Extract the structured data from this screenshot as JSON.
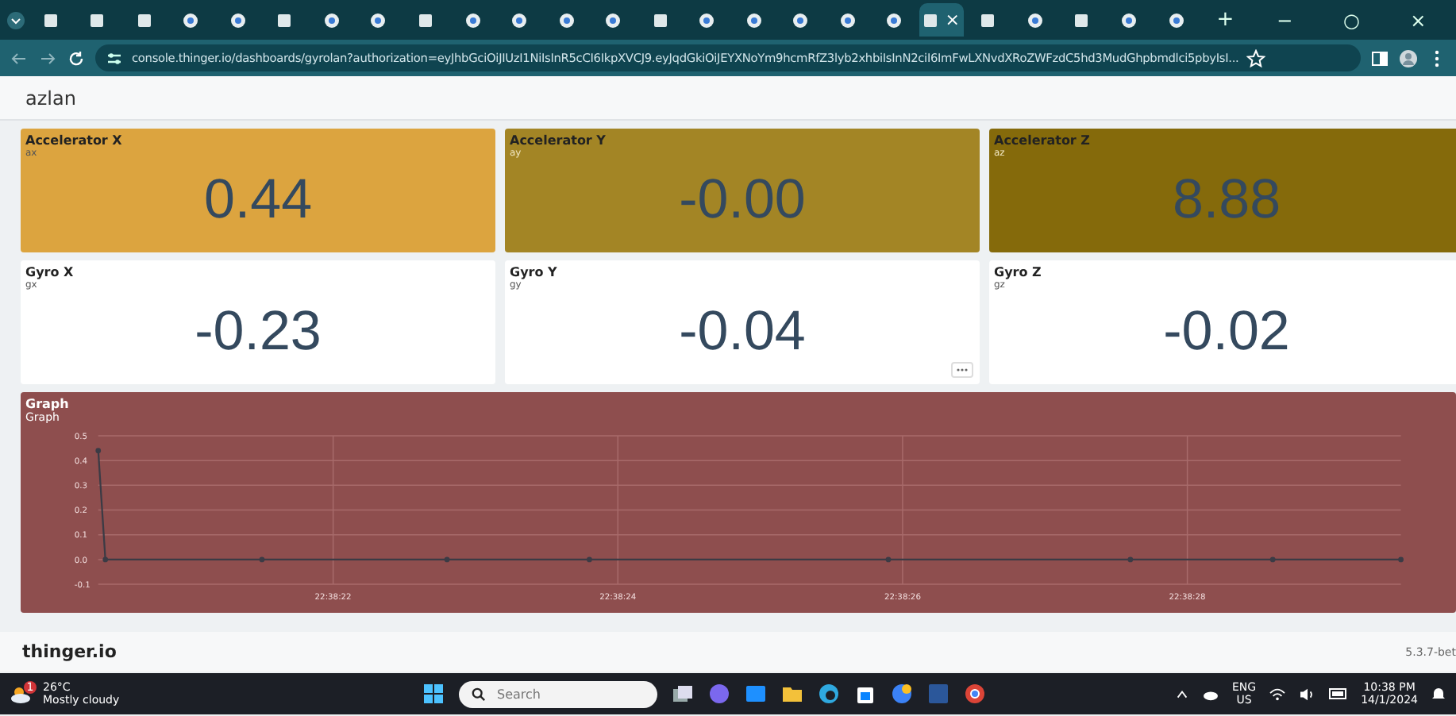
{
  "browser": {
    "tabs": [
      {
        "kind": "square",
        "selected": false
      },
      {
        "kind": "square",
        "selected": false
      },
      {
        "kind": "square",
        "selected": false
      },
      {
        "kind": "circle",
        "selected": false
      },
      {
        "kind": "circle",
        "selected": false
      },
      {
        "kind": "square",
        "selected": false
      },
      {
        "kind": "circle",
        "selected": false
      },
      {
        "kind": "circle",
        "selected": false
      },
      {
        "kind": "square",
        "selected": false
      },
      {
        "kind": "circle",
        "selected": false
      },
      {
        "kind": "circle",
        "selected": false
      },
      {
        "kind": "circle",
        "selected": false
      },
      {
        "kind": "circle",
        "selected": false
      },
      {
        "kind": "square",
        "selected": false
      },
      {
        "kind": "circle",
        "selected": false
      },
      {
        "kind": "circle",
        "selected": false
      },
      {
        "kind": "circle",
        "selected": false
      },
      {
        "kind": "circle",
        "selected": false
      },
      {
        "kind": "circle",
        "selected": false
      },
      {
        "kind": "square",
        "selected": true
      },
      {
        "kind": "square",
        "selected": false
      },
      {
        "kind": "circle",
        "selected": false
      },
      {
        "kind": "square",
        "selected": false
      },
      {
        "kind": "circle",
        "selected": false
      },
      {
        "kind": "circle",
        "selected": false
      }
    ],
    "close_tab": "×",
    "new_tab": "+",
    "window_controls": [
      "−",
      "○",
      "×"
    ],
    "url": "console.thinger.io/dashboards/gyrolan?authorization=eyJhbGciOiJIUzI1NiIsInR5cCI6IkpXVCJ9.eyJqdGkiOiJEYXNoYm9hcmRfZ3lyb2xhbiIsInN2ciI6ImFwLXNvdXRoZWFzdC5hd3MudGhpbmdlci5pbyIsI..."
  },
  "header": {
    "title": "azlan"
  },
  "widgets": [
    {
      "title": "Accelerator X",
      "subtitle": "ax",
      "value": "0.44",
      "color": "#dca43f",
      "menu_visible": false
    },
    {
      "title": "Accelerator Y",
      "subtitle": "ay",
      "value": "-0.00",
      "color": "#a38525",
      "menu_visible": false
    },
    {
      "title": "Accelerator Z",
      "subtitle": "az",
      "value": "8.88",
      "color": "#856a0b",
      "menu_visible": false
    },
    {
      "title": "Gyro X",
      "subtitle": "gx",
      "value": "-0.23",
      "color": "#ffffff",
      "menu_visible": false
    },
    {
      "title": "Gyro Y",
      "subtitle": "gy",
      "value": "-0.04",
      "color": "#ffffff",
      "menu_visible": true
    },
    {
      "title": "Gyro Z",
      "subtitle": "gz",
      "value": "-0.02",
      "color": "#ffffff",
      "menu_visible": false
    }
  ],
  "graph": {
    "title": "Graph",
    "color": "#8e4e4e",
    "chart_data": {
      "type": "line",
      "title": "Graph",
      "x": [
        81500.35,
        81500.4,
        81501.5,
        81502.8,
        81503.8,
        81505.9,
        81507.6,
        81508.6,
        81509.5
      ],
      "grid": true,
      "series": [
        {
          "color": "#3b3b45",
          "marker": true,
          "values": [
            0.44,
            0.0,
            0.0,
            0.0,
            0.0,
            0.0,
            0.0,
            0.0,
            0.0
          ]
        }
      ],
      "xlim": [
        81500.35,
        81509.5
      ],
      "ylim": [
        -0.1,
        0.5
      ],
      "xticks": [
        {
          "value": 81502,
          "label": "22:38:22"
        },
        {
          "value": 81504,
          "label": "22:38:24"
        },
        {
          "value": 81506,
          "label": "22:38:26"
        },
        {
          "value": 81508,
          "label": "22:38:28"
        }
      ],
      "yticks": [
        {
          "value": -0.1,
          "label": "-0.1"
        },
        {
          "value": 0,
          "label": "0.0"
        },
        {
          "value": 0.1,
          "label": "0.1"
        },
        {
          "value": 0.2,
          "label": "0.2"
        },
        {
          "value": 0.3,
          "label": "0.3"
        },
        {
          "value": 0.4,
          "label": "0.4"
        },
        {
          "value": 0.5,
          "label": "0.5"
        }
      ]
    }
  },
  "footer": {
    "logo": "thinger.io",
    "version": "5.3.7-bet"
  },
  "taskbar": {
    "weather_badge": "1",
    "temperature": "26°C",
    "weather": "Mostly cloudy",
    "search_placeholder": "Search",
    "language": "ENG",
    "region": "US",
    "time": "10:38 PM",
    "date": "14/1/2024"
  }
}
